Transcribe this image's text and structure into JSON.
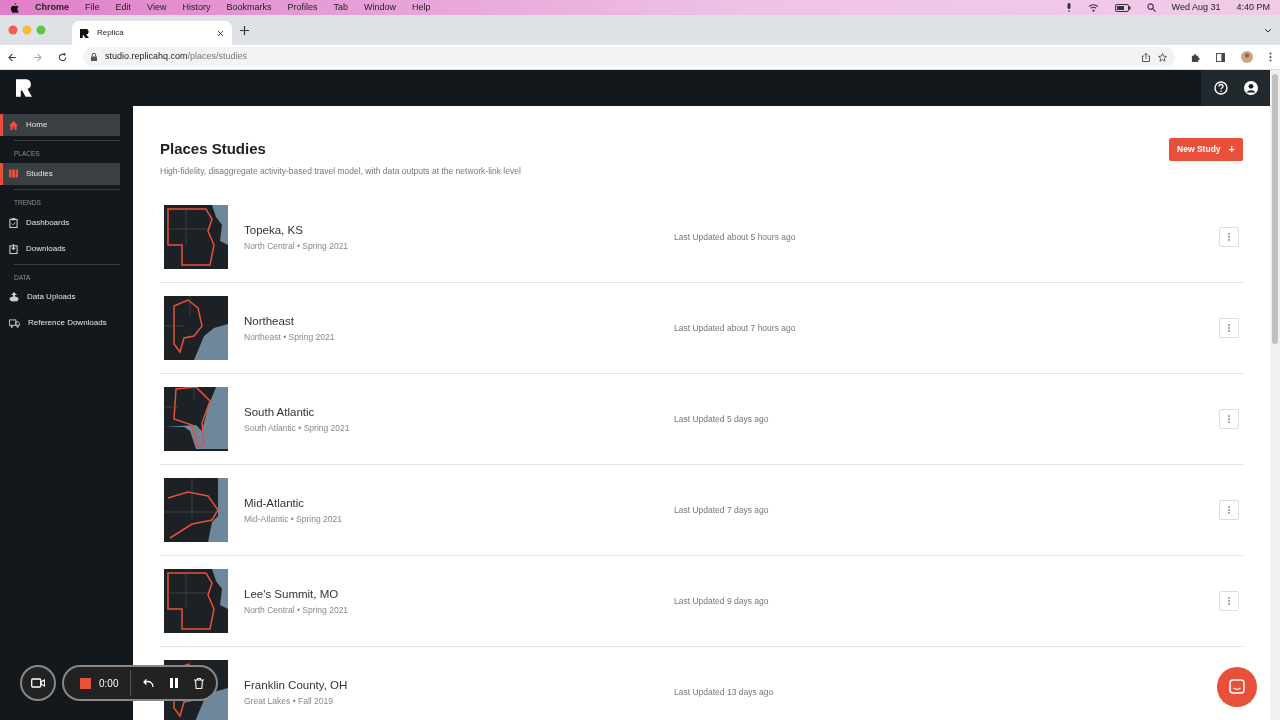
{
  "menubar": {
    "app": "Chrome",
    "menus": [
      "File",
      "Edit",
      "View",
      "History",
      "Bookmarks",
      "Profiles",
      "Tab",
      "Window",
      "Help"
    ],
    "date": "Wed Aug 31",
    "time": "4:40 PM"
  },
  "browser": {
    "tab_title": "Replica",
    "url_host": "studio.replicahq.com",
    "url_path": "/places/studies"
  },
  "sidebar": {
    "sections": [
      {
        "items": [
          {
            "label": "Home",
            "kind": "home",
            "selected": true
          }
        ]
      },
      {
        "heading": "PLACES",
        "items": [
          {
            "label": "Studies",
            "kind": "map",
            "selected": true
          }
        ]
      },
      {
        "heading": "TRENDS",
        "items": [
          {
            "label": "Dashboards",
            "kind": "clipboard",
            "selected": false
          },
          {
            "label": "Downloads",
            "kind": "download",
            "selected": false
          }
        ]
      },
      {
        "heading": "DATA",
        "items": [
          {
            "label": "Data Uploads",
            "kind": "upload",
            "selected": false
          },
          {
            "label": "Reference Downloads",
            "kind": "truck",
            "selected": false
          }
        ]
      }
    ]
  },
  "page": {
    "title": "Places Studies",
    "subtitle": "High-fidelity, disaggregate activity-based travel model, with data outputs at the network-link level",
    "new_button": "New Study",
    "new_icon": "+"
  },
  "studies": [
    {
      "name": "Topeka, KS",
      "meta": "North Central • Spring 2021",
      "updated": "Last Updated about 5 hours ago"
    },
    {
      "name": "Northeast",
      "meta": "Northeast • Spring 2021",
      "updated": "Last Updated about 7 hours ago"
    },
    {
      "name": "South Atlantic",
      "meta": "South Atlantic • Spring 2021",
      "updated": "Last Updated 5 days ago"
    },
    {
      "name": "Mid-Atlantic",
      "meta": "Mid-Atlantic • Spring 2021",
      "updated": "Last Updated 7 days ago"
    },
    {
      "name": "Lee's Summit, MO",
      "meta": "North Central • Spring 2021",
      "updated": "Last Updated 9 days ago"
    },
    {
      "name": "Franklin County, OH",
      "meta": "Great Lakes • Fall 2019",
      "updated": "Last Updated 13 days ago"
    }
  ],
  "recorder": {
    "time": "0:00"
  }
}
